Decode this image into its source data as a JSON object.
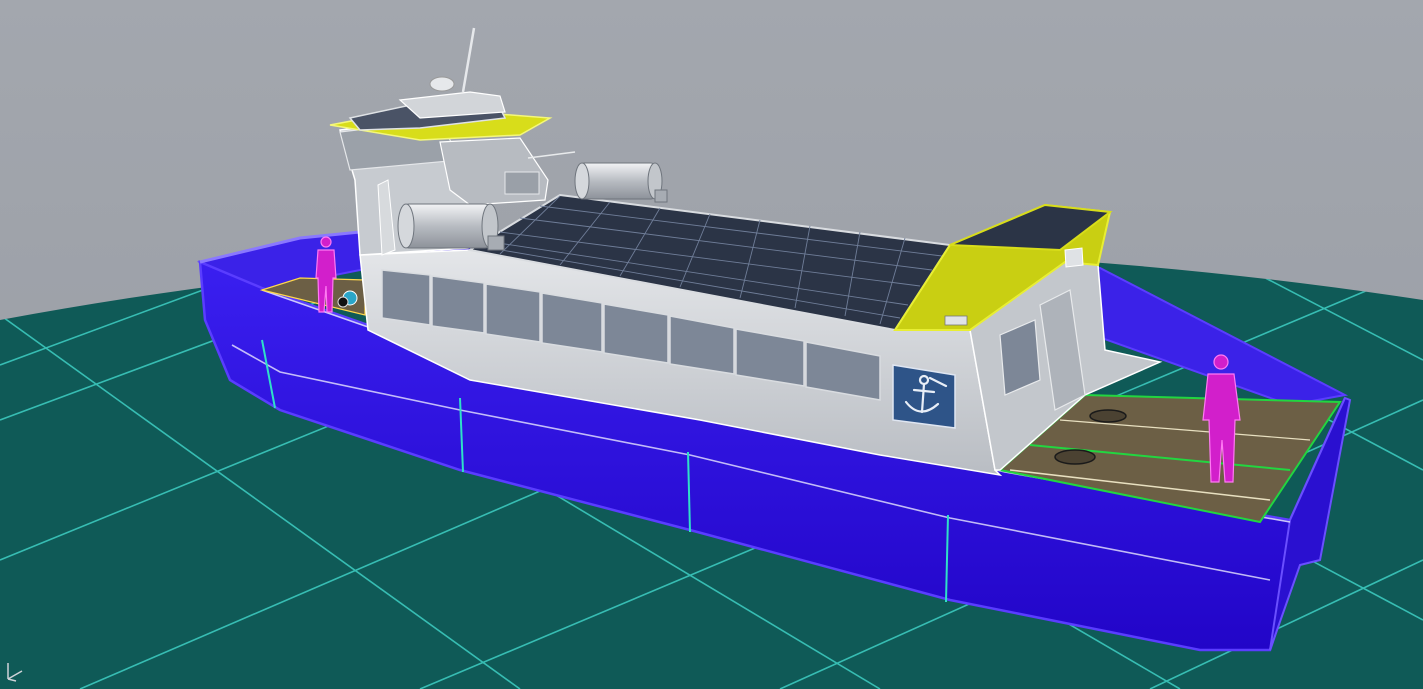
{
  "viewport": {
    "background_color": "#9ea2a9",
    "ground_color": "#0f5a57",
    "grid_color": "#3fcfc4"
  },
  "vessel": {
    "hull_color": "#2a0ee0",
    "hull_edge_color": "#5a3dff",
    "hull_seam_color": "#2fe0c8",
    "superstructure_color": "#cfd2d6",
    "window_color": "#7d8797",
    "roof_accent_color": "#d8dd1a",
    "solar_panel_color": "#2b3446",
    "deck_color": "#6c5f45",
    "deck_line_color": "#22d640",
    "figure_color": "#d21fcb",
    "emblem_color": "#2e5488"
  },
  "icons": {
    "axis_gizmo": "axis-gizmo-icon",
    "emblem": "anchor-icon"
  }
}
